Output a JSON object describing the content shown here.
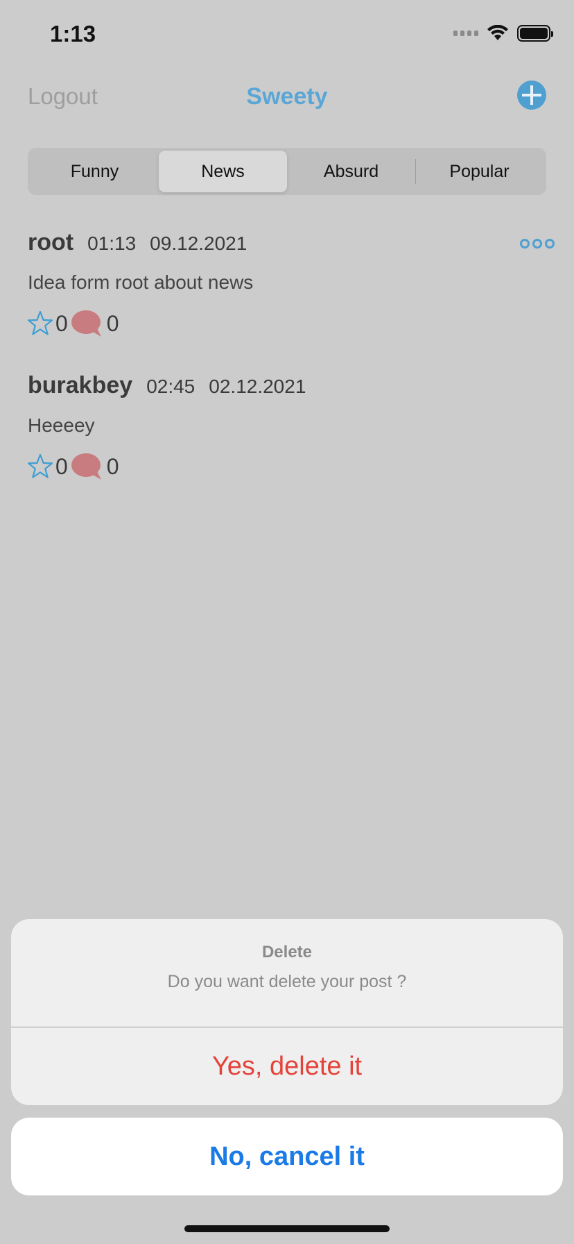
{
  "status_bar": {
    "time": "1:13"
  },
  "nav": {
    "logout": "Logout",
    "title": "Sweety",
    "add_icon": "plus-circle-icon",
    "accent": "#5aa6d6"
  },
  "tabs": [
    {
      "label": "Funny",
      "active": false
    },
    {
      "label": "News",
      "active": true
    },
    {
      "label": "Absurd",
      "active": false
    },
    {
      "label": "Popular",
      "active": false
    }
  ],
  "posts": [
    {
      "author": "root",
      "time": "01:13",
      "date": "09.12.2021",
      "body": "Idea form root about news",
      "likes": "0",
      "comments": "0"
    },
    {
      "author": "burakbey",
      "time": "02:45",
      "date": "02.12.2021",
      "body": "Heeeey",
      "likes": "0",
      "comments": "0"
    }
  ],
  "action_sheet": {
    "title": "Delete",
    "message": "Do you want delete your post ?",
    "destructive": "Yes, delete it",
    "cancel": "No, cancel it",
    "destructive_color": "#e4433a",
    "cancel_color": "#1a7ae6"
  }
}
